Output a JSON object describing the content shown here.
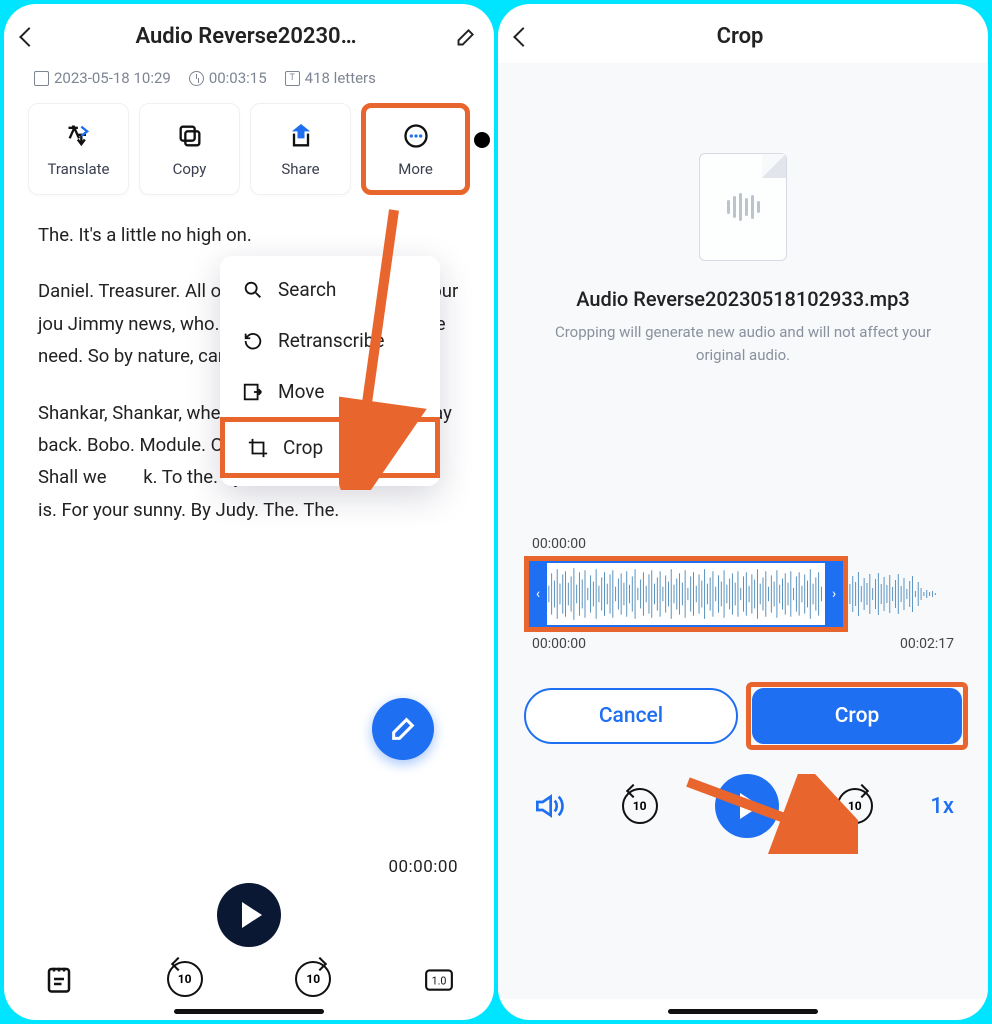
{
  "left": {
    "title": "Audio Reverse20230…",
    "meta": {
      "date": "2023-05-18 10:29",
      "duration": "00:03:15",
      "letters": "418 letters"
    },
    "actions": {
      "translate": "Translate",
      "copy": "Copy",
      "share": "Share",
      "more": "More"
    },
    "popup": {
      "search": "Search",
      "retranscribe": "Retranscribe",
      "move": "Move",
      "crop": "Crop"
    },
    "transcript": {
      "p1": "The. It's a little no high on.",
      "p2": "Daniel. Treasurer. All over the sun, w hole. Fool your jou Jimmy news, who. waves her. The soldier. She need. So by nature, can't you go one day.",
      "p3": "Shankar, Shankar, when he. What is. It's on the way back. Bobo. Module. One whole year, so. The. So. Shall we        k. To the. Sylvia. The soldier. The.           is. For your sunny. By Judy. The. The."
    },
    "timestamp": "00:00:00",
    "skip_val": "10",
    "speed_box": "1.0"
  },
  "right": {
    "title": "Crop",
    "filename": "Audio Reverse20230518102933.mp3",
    "subtitle": "Cropping will generate new audio and will not affect your original audio.",
    "start_top": "00:00:00",
    "start_bot": "00:00:00",
    "end_bot": "00:02:17",
    "cancel": "Cancel",
    "crop": "Crop",
    "skip_val": "10",
    "speed": "1x"
  }
}
